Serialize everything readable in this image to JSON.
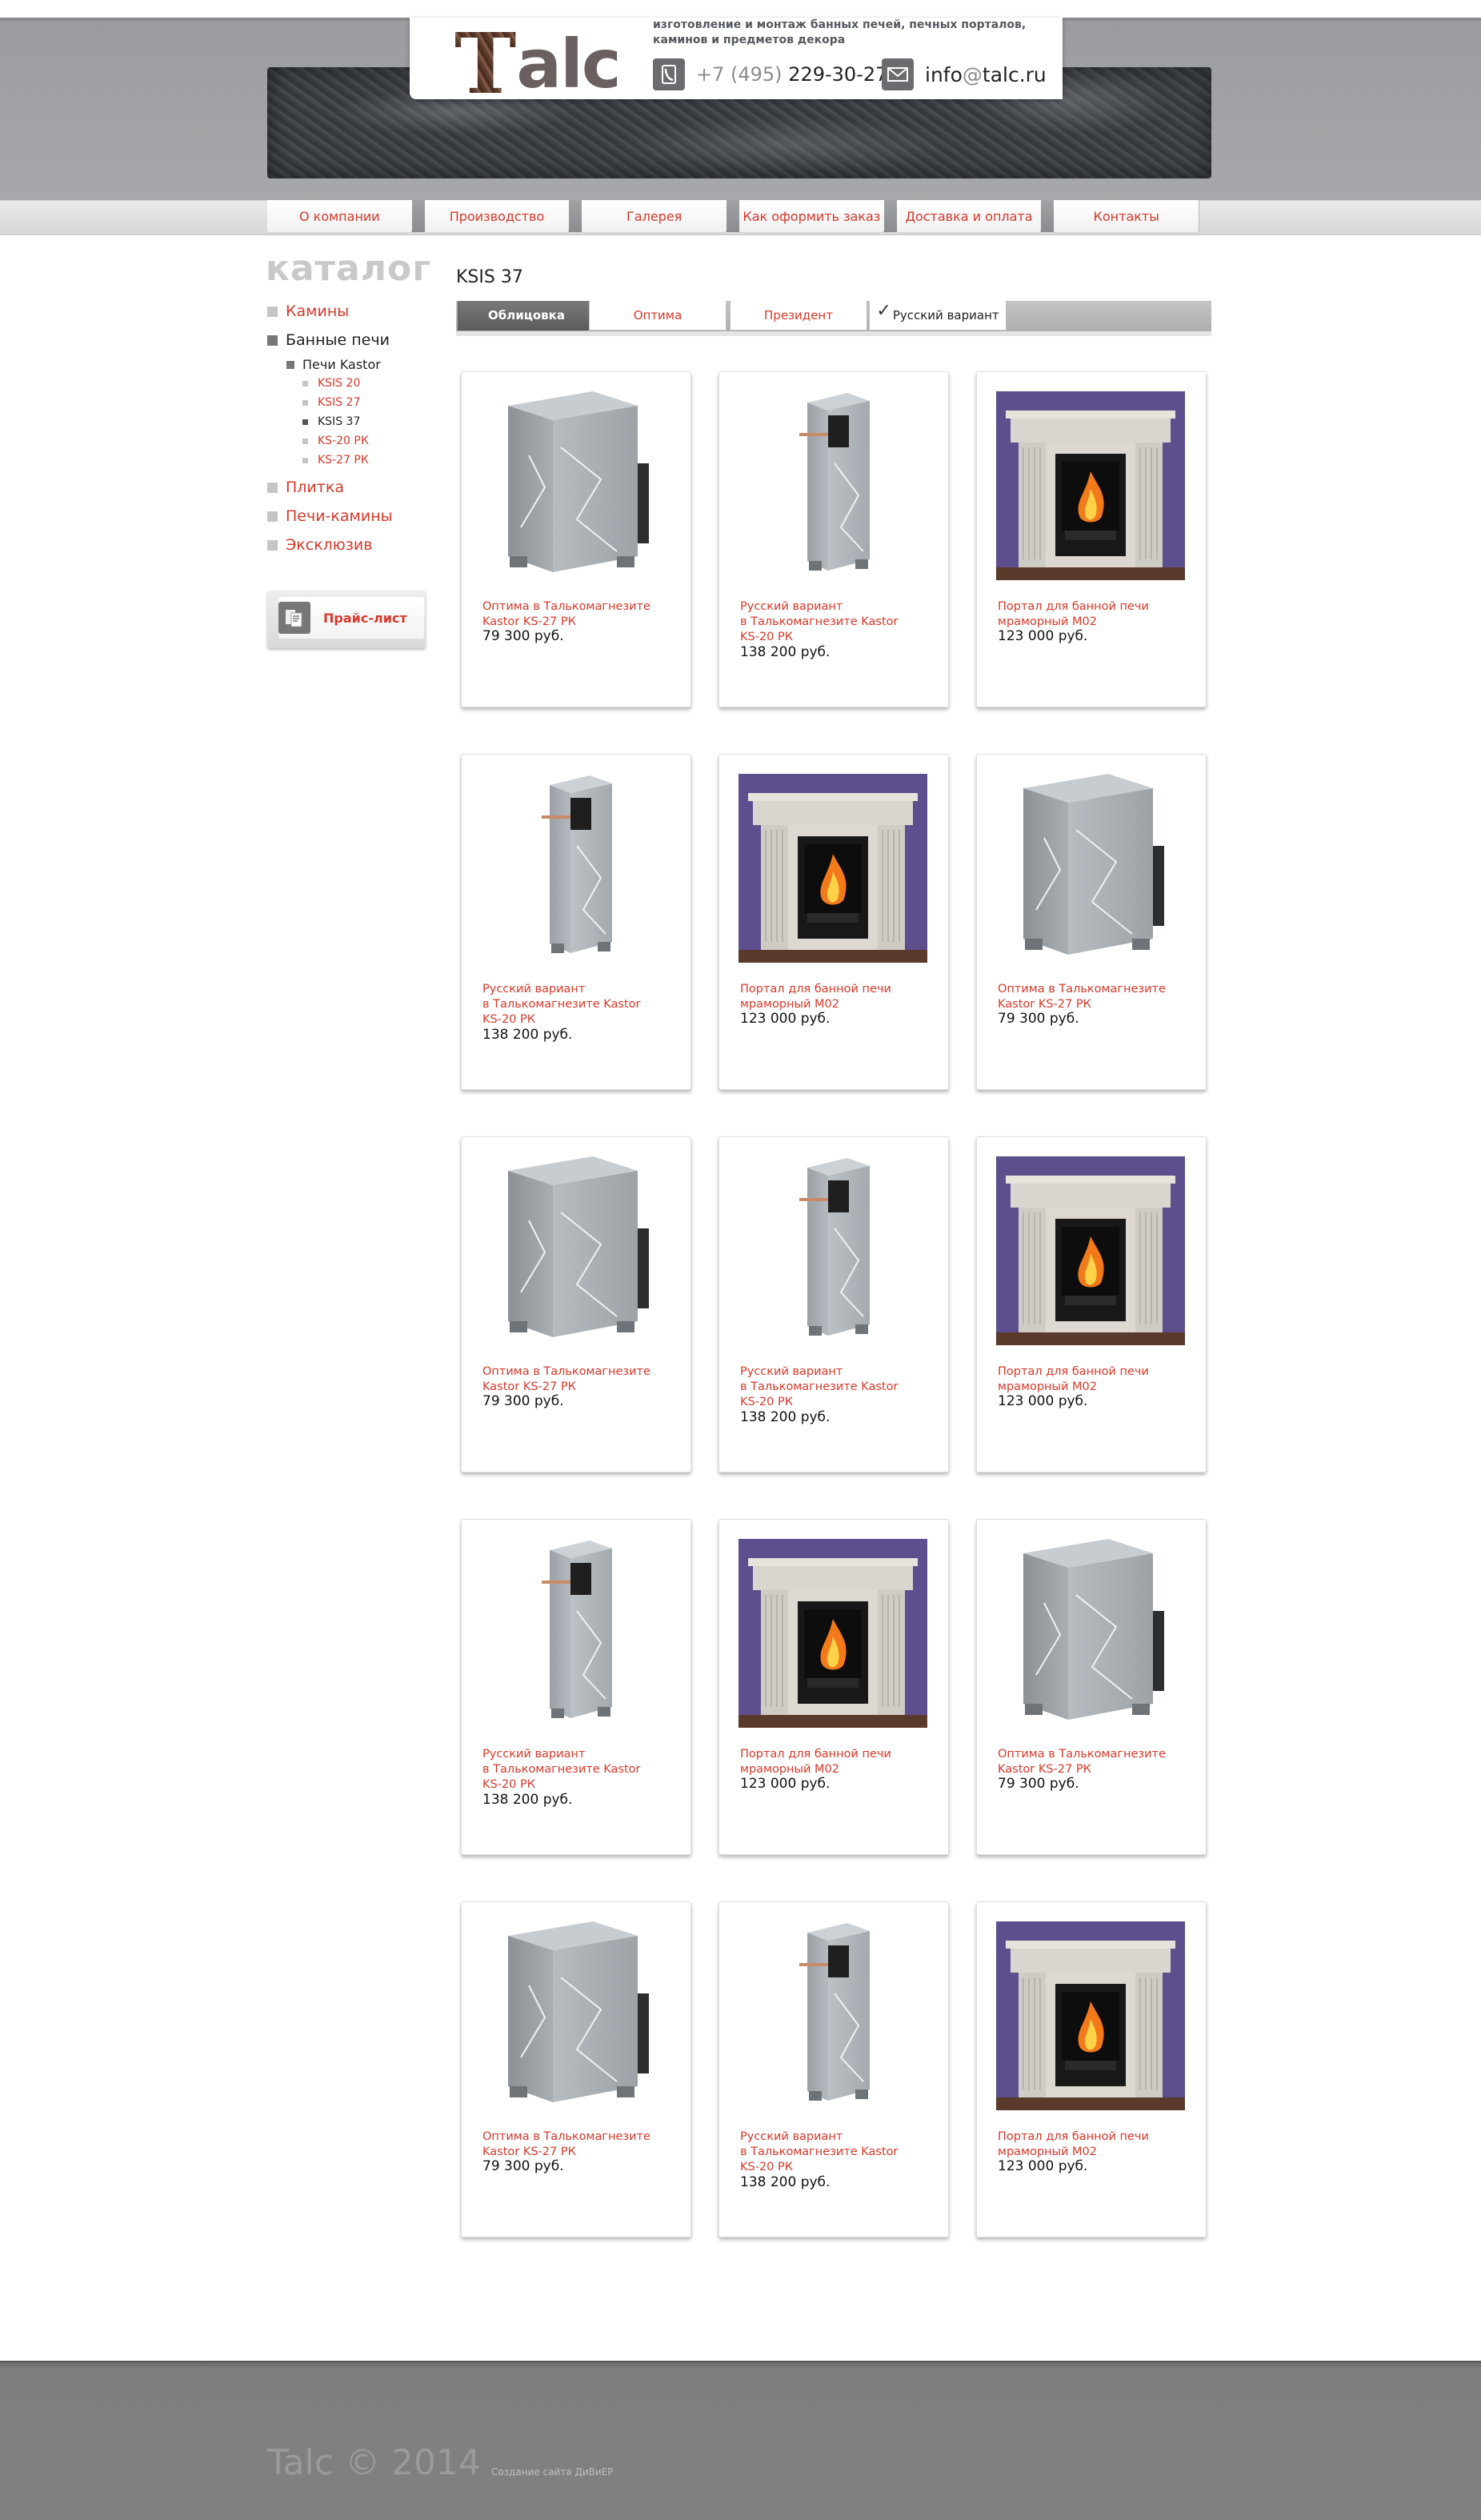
{
  "brand": {
    "logo_first": "T",
    "logo_rest": "alc",
    "tagline": "изготовление и монтаж банных печей, печных порталов, каминов и предметов декора",
    "phone_code": "+7 (495)",
    "phone_number": "229-30-27",
    "email_user": "info",
    "email_at": "@",
    "email_domain": "talc.ru"
  },
  "nav": [
    "О компании",
    "Производство",
    "Галерея",
    "Как оформить заказ",
    "Доставка и оплата",
    "Контакты"
  ],
  "sidebar": {
    "title": "каталог",
    "kaminy": "Камины",
    "bannye": "Банные печи",
    "kastor": "Печи Kastor",
    "ksis20": "KSIS 20",
    "ksis27": "KSIS 27",
    "ksis37": "KSIS 37",
    "ks20": "KS-20 РК",
    "ks27": "KS-27 РК",
    "plitka": "Плитка",
    "pechi_kaminy": "Печи-камины",
    "exclusive": "Эксклюзив",
    "price_list": "Прайс-лист"
  },
  "main": {
    "title": "KSIS 37",
    "tabs": [
      "Облицовка",
      "Оптима",
      "Президент",
      "Русский вариант"
    ],
    "active_tab": "Облицовка"
  },
  "products": [
    {
      "type": "stove-wide",
      "l1": "Оптима в Талькомагнезите",
      "l2": "Kastor KS-27 РК",
      "l3": "",
      "price": "79 300 руб."
    },
    {
      "type": "stove-narrow",
      "l1": "Русский вариант",
      "l2": "в Талькомагнезите Kastor",
      "l3": "KS-20 РК",
      "price": "138 200 руб."
    },
    {
      "type": "portal",
      "l1": "Портал для банной печи",
      "l2": "мраморный М02",
      "l3": "",
      "price": "123 000 руб."
    },
    {
      "type": "stove-narrow",
      "l1": "Русский вариант",
      "l2": "в Талькомагнезите Kastor",
      "l3": "KS-20 РК",
      "price": "138 200 руб."
    },
    {
      "type": "portal",
      "l1": "Портал для банной печи",
      "l2": "мраморный М02",
      "l3": "",
      "price": "123 000 руб."
    },
    {
      "type": "stove-wide",
      "l1": "Оптима в Талькомагнезите",
      "l2": "Kastor KS-27 РК",
      "l3": "",
      "price": "79 300 руб."
    },
    {
      "type": "stove-wide",
      "l1": "Оптима в Талькомагнезите",
      "l2": "Kastor KS-27 РК",
      "l3": "",
      "price": "79 300 руб."
    },
    {
      "type": "stove-narrow",
      "l1": "Русский вариант",
      "l2": "в Талькомагнезите Kastor",
      "l3": "KS-20 РК",
      "price": "138 200 руб."
    },
    {
      "type": "portal",
      "l1": "Портал для банной печи",
      "l2": "мраморный М02",
      "l3": "",
      "price": "123 000 руб."
    },
    {
      "type": "stove-narrow",
      "l1": "Русский вариант",
      "l2": "в Талькомагнезите Kastor",
      "l3": "KS-20 РК",
      "price": "138 200 руб."
    },
    {
      "type": "portal",
      "l1": "Портал для банной печи",
      "l2": "мраморный М02",
      "l3": "",
      "price": "123 000 руб."
    },
    {
      "type": "stove-wide",
      "l1": "Оптима в Талькомагнезите",
      "l2": "Kastor KS-27 РК",
      "l3": "",
      "price": "79 300 руб."
    },
    {
      "type": "stove-wide",
      "l1": "Оптима в Талькомагнезите",
      "l2": "Kastor KS-27 РК",
      "l3": "",
      "price": "79 300 руб."
    },
    {
      "type": "stove-narrow",
      "l1": "Русский вариант",
      "l2": "в Талькомагнезите Kastor",
      "l3": "KS-20 РК",
      "price": "138 200 руб."
    },
    {
      "type": "portal",
      "l1": "Портал для банной печи",
      "l2": "мраморный М02",
      "l3": "",
      "price": "123 000 руб."
    }
  ],
  "footer": {
    "copyright": "Talc © 2014",
    "credit": "Создание сайта ДиВиЕР"
  },
  "colors": {
    "accent": "#d8392a",
    "header_band": "#9d9fa2",
    "footer": "#7e7e7e",
    "tab_active": "#666666"
  }
}
